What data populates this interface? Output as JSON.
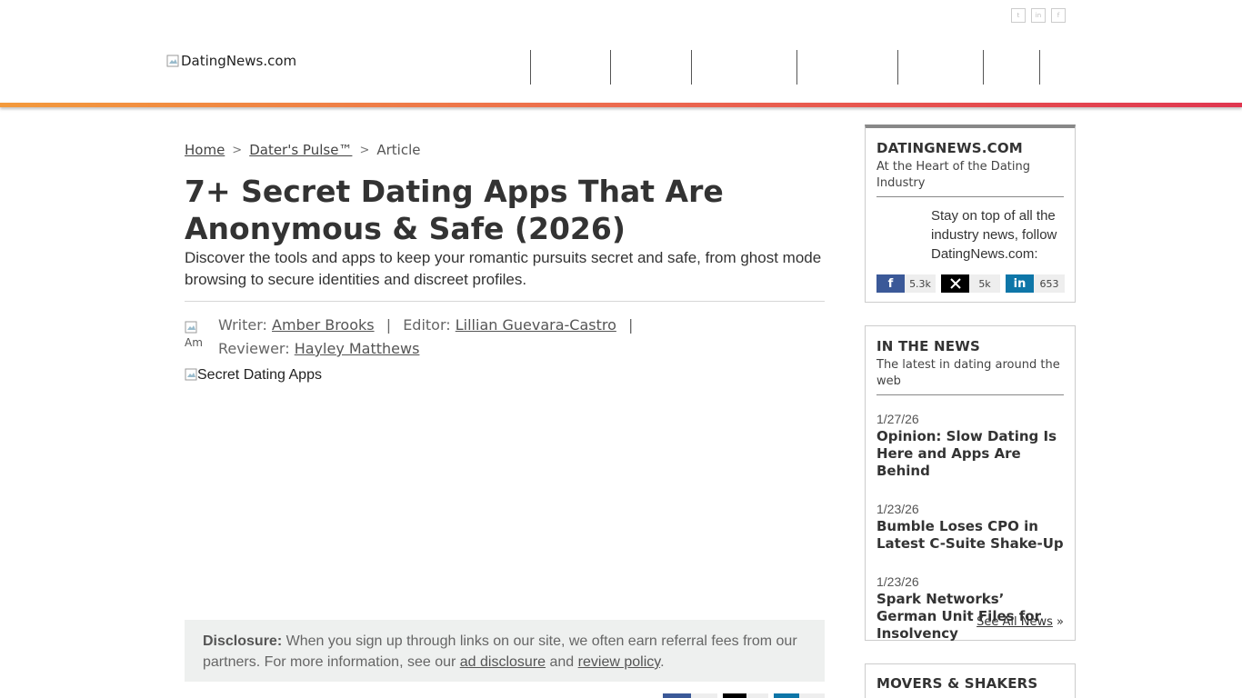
{
  "header": {
    "logo_alt": "DatingNews.com",
    "top_social": [
      "twitter-icon",
      "linkedin-icon",
      "facebook-icon"
    ],
    "accent_gradient": [
      "#f39a3c",
      "#e0364f"
    ]
  },
  "breadcrumb": {
    "home": "Home",
    "section": "Dater's Pulse™",
    "current": "Article"
  },
  "article": {
    "title": "7+ Secret Dating Apps That Are Anonymous & Safe (2026)",
    "subtitle": "Discover the tools and apps to keep your romantic pursuits secret and safe, from ghost mode browsing to secure identities and discreet profiles.",
    "avatar_alt": "Am",
    "writer_label": "Writer:",
    "writer": "Amber Brooks",
    "editor_label": "Editor:",
    "editor": "Lillian Guevara-Castro",
    "reviewer_label": "Reviewer:",
    "reviewer": "Hayley Matthews",
    "hero_alt": "Secret Dating Apps"
  },
  "disclosure": {
    "label": "Disclosure:",
    "text_1": " When you sign up through links on our site, we often earn referral fees from our partners. For more information, see our ",
    "link_1": "ad disclosure",
    "text_2": " and ",
    "link_2": "review policy",
    "text_3": "."
  },
  "sidebar": {
    "about": {
      "title": "DATINGNEWS.COM",
      "subtitle": "At the Heart of the Dating Industry",
      "follow_text": "Stay on top of all the industry news, follow DatingNews.com:",
      "buttons": [
        {
          "icon": "facebook-icon",
          "glyph": "f",
          "count": "5.3k",
          "color": "#3b5998"
        },
        {
          "icon": "x-icon",
          "glyph": "𝕏",
          "count": "5k",
          "color": "#000000"
        },
        {
          "icon": "linkedin-icon",
          "glyph": "in",
          "count": "653",
          "color": "#0e76a8"
        }
      ]
    },
    "news": {
      "title": "IN THE NEWS",
      "subtitle": "The latest in dating around the web",
      "items": [
        {
          "date": "1/27/26",
          "title": "Opinion: Slow Dating Is Here and Apps Are Behind"
        },
        {
          "date": "1/23/26",
          "title": "Bumble Loses CPO in Latest C-Suite Shake-Up"
        },
        {
          "date": "1/23/26",
          "title": "Spark Networks’ German Unit Files for Insolvency"
        }
      ],
      "see_all": "See All News",
      "see_all_arrow": "»"
    },
    "movers": {
      "title": "MOVERS & SHAKERS"
    }
  }
}
